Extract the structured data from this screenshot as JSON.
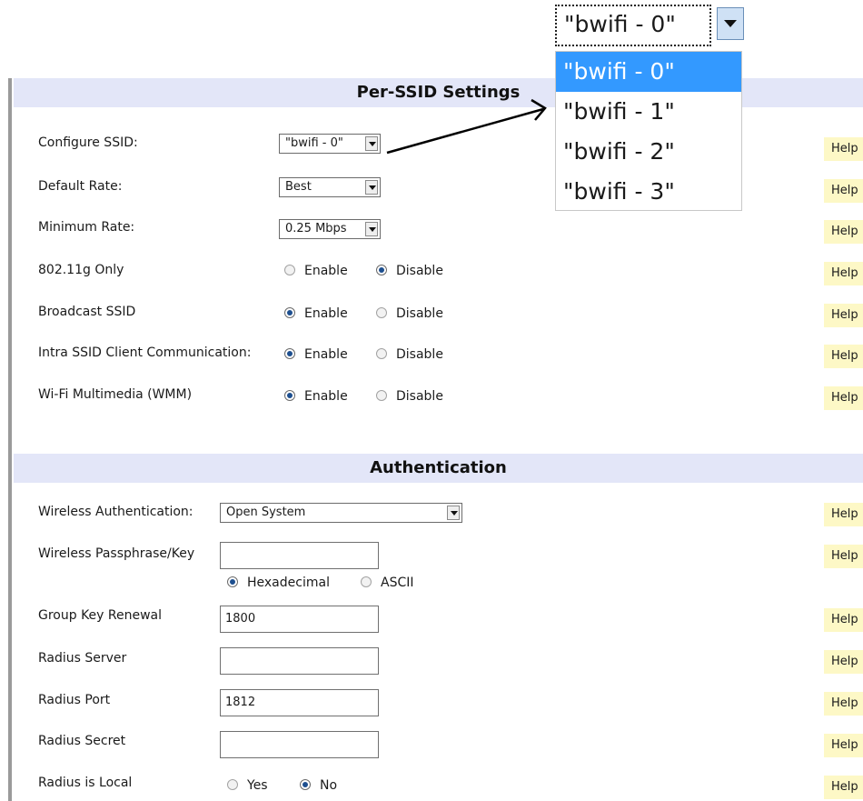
{
  "per_ssid": {
    "header": "Per-SSID Settings",
    "configure_ssid": {
      "label": "Configure SSID:",
      "value": "\"bwifi - 0\""
    },
    "default_rate": {
      "label": "Default Rate:",
      "value": "Best"
    },
    "minimum_rate": {
      "label": "Minimum Rate:",
      "value": "0.25 Mbps"
    },
    "g_only": {
      "label": "802.11g Only",
      "enable": "Enable",
      "disable": "Disable",
      "selected": "Disable"
    },
    "broadcast": {
      "label": "Broadcast SSID",
      "enable": "Enable",
      "disable": "Disable",
      "selected": "Enable"
    },
    "intra": {
      "label": "Intra SSID Client Communication:",
      "enable": "Enable",
      "disable": "Disable",
      "selected": "Enable"
    },
    "wmm": {
      "label": "Wi-Fi Multimedia (WMM)",
      "enable": "Enable",
      "disable": "Disable",
      "selected": "Enable"
    }
  },
  "auth": {
    "header": "Authentication",
    "wireless_auth": {
      "label": "Wireless Authentication:",
      "value": "Open System"
    },
    "passphrase": {
      "label": "Wireless Passphrase/Key",
      "value": "",
      "hex": "Hexadecimal",
      "ascii": "ASCII",
      "selected": "Hexadecimal"
    },
    "group_key": {
      "label": "Group Key Renewal",
      "value": "1800"
    },
    "radius_server": {
      "label": "Radius Server",
      "value": ""
    },
    "radius_port": {
      "label": "Radius Port",
      "value": "1812"
    },
    "radius_secret": {
      "label": "Radius Secret",
      "value": ""
    },
    "radius_local": {
      "label": "Radius is Local",
      "yes": "Yes",
      "no": "No",
      "selected": "No"
    }
  },
  "help_label": "Help",
  "zoom": {
    "selected": "\"bwifi - 0\"",
    "options": [
      "\"bwifi - 0\"",
      "\"bwifi - 1\"",
      "\"bwifi - 2\"",
      "\"bwifi - 3\""
    ],
    "highlighted_index": 0
  },
  "colors": {
    "header_bg": "#e3e6f8",
    "help_bg": "#fdf8c6",
    "highlight": "#3399ff"
  }
}
